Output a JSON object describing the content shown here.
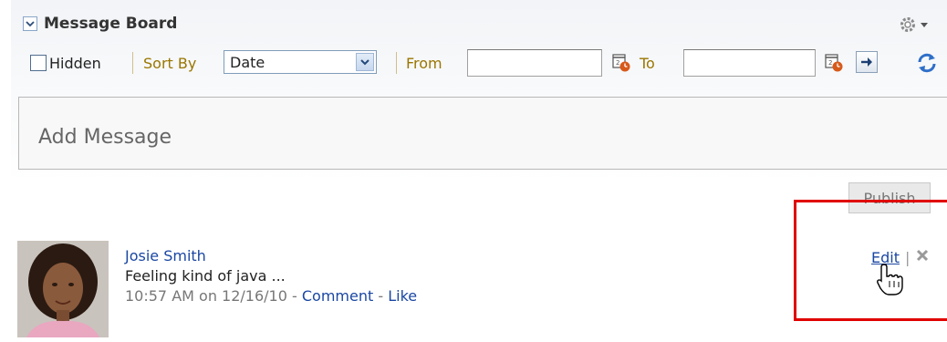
{
  "panel": {
    "title": "Message Board"
  },
  "toolbar": {
    "hidden_label": "Hidden",
    "sort_by_label": "Sort By",
    "sort_value": "Date",
    "from_label": "From",
    "from_value": "",
    "to_label": "To",
    "to_value": ""
  },
  "composer": {
    "placeholder": "Add Message",
    "publish_label": "Publish"
  },
  "messages": [
    {
      "author": "Josie Smith",
      "text": "Feeling kind of java ...",
      "timestamp": "10:57 AM on 12/16/10",
      "dash1": " - ",
      "comment_label": "Comment",
      "dash2": " - ",
      "like_label": "Like",
      "edit_label": "Edit",
      "separator": "|"
    }
  ],
  "colors": {
    "link": "#1a47a3",
    "label_gold": "#9a7600",
    "highlight": "#e00000"
  },
  "icons": [
    "chevron-down-icon",
    "gear-icon",
    "calendar-icon",
    "arrow-right-icon",
    "refresh-icon",
    "delete-icon",
    "hand-cursor-icon"
  ]
}
